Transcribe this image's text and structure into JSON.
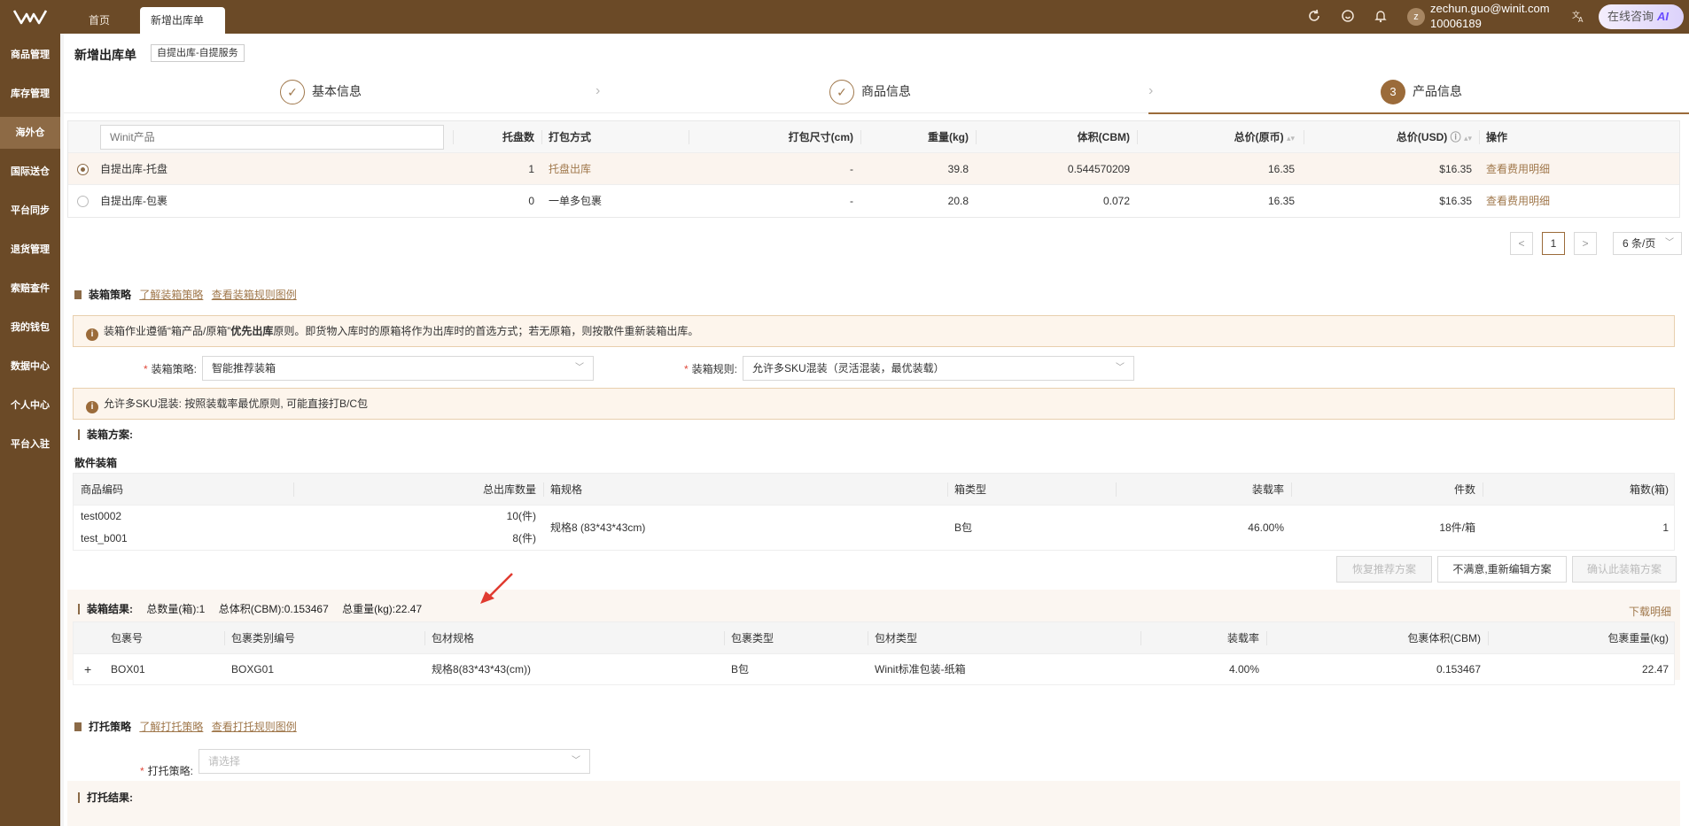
{
  "topbar": {
    "tabs": [
      {
        "label": "首页"
      },
      {
        "label": "新增出库单",
        "close": "×"
      }
    ],
    "user": {
      "avatar": "z",
      "email": "zechun.guo@winit.com",
      "id": "10006189"
    },
    "ai_button": {
      "label": "在线咨询",
      "badge": "AI"
    },
    "icons": [
      "refresh-icon",
      "help-icon",
      "bell-icon",
      "translate-icon"
    ]
  },
  "sidebar": {
    "items": [
      "商品管理",
      "库存管理",
      "海外仓",
      "国际送仓",
      "平台同步",
      "退货管理",
      "索赔查件",
      "我的钱包",
      "数据中心",
      "个人中心",
      "平台入驻"
    ],
    "active_index": 2
  },
  "page": {
    "title": "新增出库单",
    "tag": "自提出库-自提服务"
  },
  "steps": [
    {
      "label": "基本信息",
      "state": "done",
      "mark": "✓"
    },
    {
      "label": "商品信息",
      "state": "done",
      "mark": "✓"
    },
    {
      "label": "产品信息",
      "state": "current",
      "mark": "3"
    }
  ],
  "product_table": {
    "search_placeholder": "Winit产品",
    "headers": {
      "pallets": "托盘数",
      "pack_method": "打包方式",
      "pack_size": "打包尺寸(cm)",
      "weight": "重量(kg)",
      "volume": "体积(CBM)",
      "total_orig": "总价(原币)",
      "total_usd": "总价(USD)",
      "action": "操作"
    },
    "rows": [
      {
        "name": "自提出库-托盘",
        "pallets": "1",
        "pack_method": "托盘出库",
        "pack_size": "-",
        "weight": "39.8",
        "volume": "0.544570209",
        "total_orig": "16.35",
        "total_usd": "$16.35",
        "action": "查看费用明细",
        "selected": true
      },
      {
        "name": "自提出库-包裹",
        "pallets": "0",
        "pack_method": "一单多包裹",
        "pack_size": "-",
        "weight": "20.8",
        "volume": "0.072",
        "total_orig": "16.35",
        "total_usd": "$16.35",
        "action": "查看费用明细",
        "selected": false
      }
    ]
  },
  "pager": {
    "prev": "<",
    "page": "1",
    "next": ">",
    "size": "6 条/页"
  },
  "packing": {
    "title": "装箱策略",
    "link1": "了解装箱策略",
    "link2": "查看装箱规则图例",
    "notice_pre": "装箱作业遵循“箱产品/原箱”",
    "notice_bold": "优先出库",
    "notice_post": "原则。即货物入库时的原箱将作为出库时的首选方式；若无原箱，则按散件重新装箱出库。",
    "strategy_label": "装箱策略:",
    "strategy_value": "智能推荐装箱",
    "rule_label": "装箱规则:",
    "rule_value": "允许多SKU混装（灵活混装，最优装载）",
    "rule_notice": "允许多SKU混装: 按照装载率最优原则, 可能直接打B/C包"
  },
  "plan": {
    "title": "装箱方案:",
    "sub": "散件装箱",
    "headers": {
      "sku": "商品编码",
      "qty": "总出库数量",
      "spec": "箱规格",
      "type": "箱类型",
      "rate": "装载率",
      "pieces": "件数",
      "boxes": "箱数(箱)"
    },
    "items": [
      {
        "sku": "test0002",
        "qty": "10(件)"
      },
      {
        "sku": "test_b001",
        "qty": "8(件)"
      }
    ],
    "spec": "规格8 (83*43*43cm)",
    "type": "B包",
    "rate": "46.00%",
    "pieces": "18件/箱",
    "boxes": "1",
    "buttons": {
      "restore": "恢复推荐方案",
      "edit": "不满意,重新编辑方案",
      "confirm": "确认此装箱方案"
    }
  },
  "result": {
    "title": "装箱结果:",
    "total_boxes": "总数量(箱):1",
    "total_volume": "总体积(CBM):0.153467",
    "total_weight": "总重量(kg):22.47",
    "download": "下载明细",
    "headers": {
      "pkg_no": "包裹号",
      "pkg_cat": "包裹类别编号",
      "material_spec": "包材规格",
      "pkg_type": "包裹类型",
      "material_type": "包材类型",
      "rate": "装载率",
      "volume": "包裹体积(CBM)",
      "weight": "包裹重量(kg)"
    },
    "rows": [
      {
        "expand": "+",
        "pkg_no": "BOX01",
        "pkg_cat": "BOXG01",
        "material_spec": "规格8(83*43*43(cm))",
        "pkg_type": "B包",
        "material_type": "Winit标准包装-纸箱",
        "rate": "4.00%",
        "volume": "0.153467",
        "weight": "22.47"
      }
    ]
  },
  "pallet": {
    "title": "打托策略",
    "link1": "了解打托策略",
    "link2": "查看打托规则图例",
    "strategy_label": "打托策略:",
    "strategy_placeholder": "请选择",
    "result_title": "打托结果:"
  },
  "colors": {
    "brand": "#6b4a27",
    "accent": "#9b6b3a",
    "arrow": "#e03a2f"
  }
}
